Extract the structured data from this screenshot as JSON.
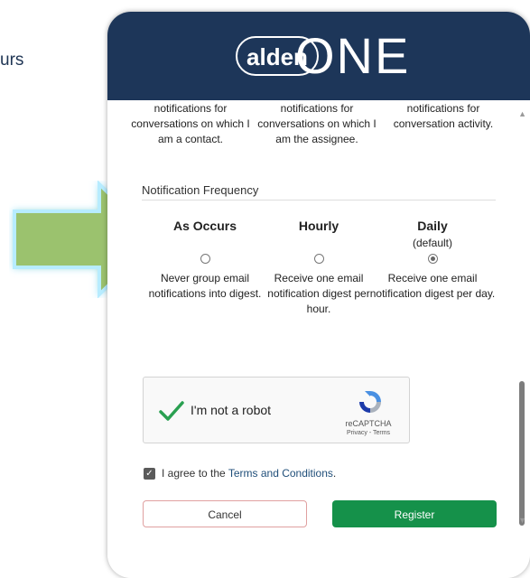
{
  "background": {
    "partial_text": "urs"
  },
  "header": {
    "logo_left": "alden",
    "logo_right": "ONE"
  },
  "notification_types": {
    "cut_line": "notifications for",
    "columns": [
      "conversations on which I am a contact.",
      "conversations on which I am the assignee.",
      "conversation activity."
    ]
  },
  "frequency": {
    "section_title": "Notification Frequency",
    "options": [
      {
        "title": "As Occurs",
        "subtitle": "",
        "description": "Never group email notifications into digest.",
        "selected": false
      },
      {
        "title": "Hourly",
        "subtitle": "",
        "description": "Receive one email notification digest per hour.",
        "selected": false
      },
      {
        "title": "Daily",
        "subtitle": "(default)",
        "description": "Receive one email notification digest per day.",
        "selected": true
      }
    ]
  },
  "captcha": {
    "label": "I'm not a robot",
    "brand": "reCAPTCHA",
    "links": "Privacy - Terms"
  },
  "agreement": {
    "prefix": "I agree to the ",
    "link": "Terms and Conditions",
    "suffix": "."
  },
  "buttons": {
    "cancel": "Cancel",
    "register": "Register"
  },
  "colors": {
    "header": "#1d3659",
    "register": "#15914a",
    "arrow": "#9bc26e",
    "arrow_glow": "#9fe3ff"
  }
}
